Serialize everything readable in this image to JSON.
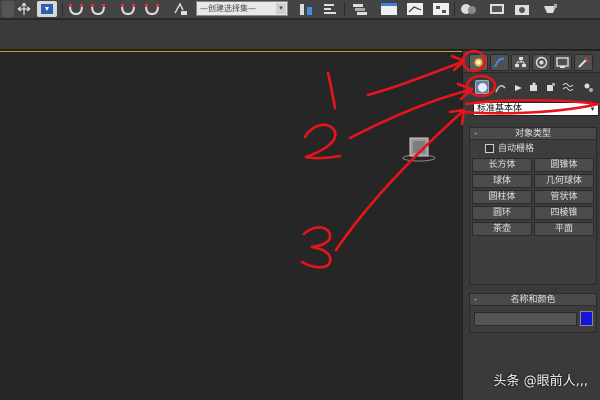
{
  "toolbar": {
    "named_selection": "—创建选择集—",
    "dropdown_arrow": "▾",
    "icons": [
      "move-icon",
      "select-icon",
      "snap-icon",
      "snap-angle-icon",
      "percent-snap-icon",
      "spinner-snap-icon",
      "named-selection-icon",
      "mirror-icon",
      "align-icon",
      "layer-icon",
      "graphite-icon",
      "curve-editor-icon",
      "schematic-icon",
      "material-editor-icon",
      "render-setup-icon",
      "render-frame-icon",
      "render-icon"
    ]
  },
  "command_panel": {
    "tabs": [
      "create-tab",
      "modify-tab",
      "hierarchy-tab",
      "motion-tab",
      "display-tab",
      "utilities-tab"
    ],
    "active_tab": "create-tab",
    "categories": [
      "geometry-icon",
      "shapes-icon",
      "lights-icon",
      "cameras-icon",
      "helpers-icon",
      "spacewarps-icon",
      "systems-icon"
    ],
    "active_category": "geometry-icon",
    "type_select": {
      "value": "标准基本体",
      "arrow": "▾"
    },
    "object_type": {
      "title": "对象类型",
      "collapse": "-",
      "autogrid": "自动栅格",
      "buttons": [
        "长方体",
        "圆锥体",
        "球体",
        "几何球体",
        "圆柱体",
        "管状体",
        "圆环",
        "四棱锥",
        "茶壶",
        "平面"
      ]
    },
    "name_color": {
      "title": "名称和颜色",
      "collapse": "-",
      "swatch_color": "#1515d6"
    }
  },
  "annotations": {
    "color": "#e8141b",
    "labels": [
      "1",
      "2",
      "3"
    ]
  },
  "watermark": "头条 @眼前人,,,"
}
